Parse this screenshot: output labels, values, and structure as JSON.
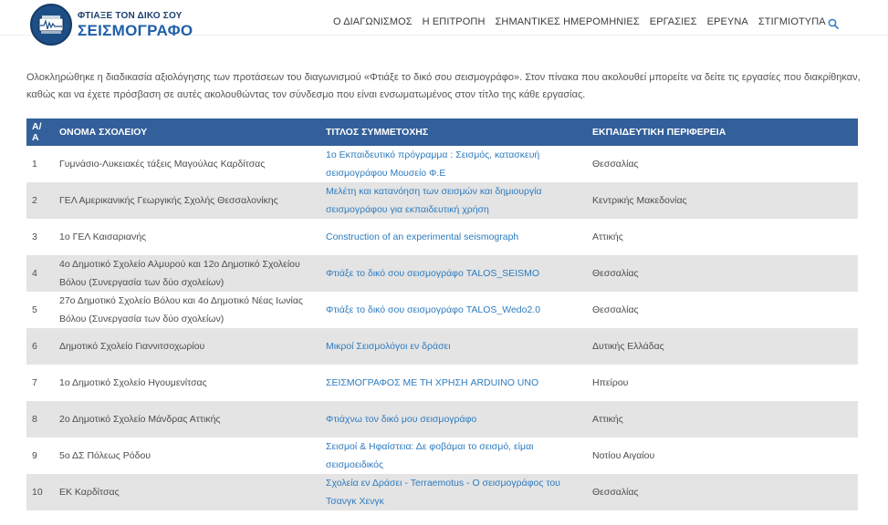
{
  "header": {
    "logo": {
      "line1": "ΦΤΙΑΞΕ ΤΟΝ ΔΙΚΟ ΣΟΥ",
      "line2": "ΣΕΙΣΜΟΓΡΑΦΟ"
    },
    "nav": [
      {
        "label": "Ο ΔΙΑΓΩΝΙΣΜΟΣ"
      },
      {
        "label": "Η ΕΠΙΤΡΟΠΗ"
      },
      {
        "label": "ΣΗΜΑΝΤΙΚΕΣ ΗΜΕΡΟΜΗΝΙΕΣ"
      },
      {
        "label": "ΕΡΓΑΣΙΕΣ"
      },
      {
        "label": "ΕΡΕΥΝΑ"
      },
      {
        "label": "ΣΤΙΓΜΙΟΤΥΠΑ"
      }
    ]
  },
  "intro": "Ολοκληρώθηκε η διαδικασία αξιολόγησης των προτάσεων του διαγωνισμού «Φτιάξε το δικό σου σεισμογράφο». Στον πίνακα που ακολουθεί μπορείτε να δείτε τις εργασίες που διακρίθηκαν, καθώς και να έχετε πρόσβαση σε αυτές ακολουθώντας τον σύνδεσμο που είναι ενσωματωμένος στον τίτλο της κάθε εργασίας.",
  "table": {
    "headers": [
      "Α/Α",
      "ΟΝΟΜΑ ΣΧΟΛΕΙΟΥ",
      "ΤΙΤΛΟΣ ΣΥΜΜΕΤΟΧΗΣ",
      "ΕΚΠΑΙΔΕΥΤΙΚΗ ΠΕΡΙΦΕΡΕΙΑ"
    ],
    "rows": [
      {
        "num": "1",
        "school": "Γυμνάσιο-Λυκειακές τάξεις Μαγούλας Καρδίτσας",
        "title": "1ο Εκπαιδευτικό πρόγραμμα : Σεισμός, κατασκευή σεισμογράφου Μουσείο Φ.Ε",
        "region": "Θεσσαλίας"
      },
      {
        "num": "2",
        "school": "ΓΕΛ Αμερικανικής Γεωργικής Σχολής Θεσσαλονίκης",
        "title": "Μελέτη και κατανόηση των σεισμών και δημιουργία σεισμογράφου για εκπαιδευτική χρήση",
        "region": "Κεντρικής Μακεδονίας"
      },
      {
        "num": "3",
        "school": "1ο ΓΕΛ Καισαριανής",
        "title": "Construction of an experimental seismograph",
        "region": "Αττικής"
      },
      {
        "num": "4",
        "school": "4ο Δημοτικό Σχολείο Αλμυρού και 12ο Δημοτικό Σχολείου Βόλου (Συνεργασία των δύο σχολείων)",
        "title": "Φτιάξε το δικό σου σεισμογράφο TALOS_SEISMO",
        "region": "Θεσσαλίας"
      },
      {
        "num": "5",
        "school": "27ο Δημοτικό Σχολείο Βόλου και 4ο Δημοτικό Νέας Ιωνίας Βόλου (Συνεργασία των δύο σχολείων)",
        "title": "Φτιάξε το δικό σου σεισμογράφο TALOS_Wedo2.0",
        "region": "Θεσσαλίας"
      },
      {
        "num": "6",
        "school": "Δημοτικό Σχολείο Γιαννιτσοχωρίου",
        "title": "Μικροί Σεισμολόγοι εν δράσει",
        "region": "Δυτικής Ελλάδας"
      },
      {
        "num": "7",
        "school": "1ο Δημοτικό Σχολείο Ηγουμενίτσας",
        "title": "ΣΕΙΣΜΟΓΡΑΦΟΣ ΜΕ ΤΗ ΧΡΗΣΗ ARDUINO UNO",
        "region": "Ηπείρου"
      },
      {
        "num": "8",
        "school": "2ο Δημοτικό Σχολείο Μάνδρας Αττικής",
        "title": "Φτιάχνω τον δικό μου σεισμογράφο",
        "region": "Αττικής"
      },
      {
        "num": "9",
        "school": "5ο ΔΣ Πόλεως Ρόδου",
        "title": "Σεισμοί & Ηφαίστεια: Δε φοβάμαι το σεισμό, είμαι σεισμοειδικός",
        "region": "Νοτίου Αιγαίου"
      },
      {
        "num": "10",
        "school": "ΕΚ Καρδίτσας",
        "title": "Σχολεία εν Δράσει - Terraemotus - Ο σεισμογράφος του Τσανγκ Χενγκ",
        "region": "Θεσσαλίας"
      }
    ]
  },
  "colors": {
    "header_bg": "#33609a",
    "link": "#2d7bbf",
    "stripe": "#e4e4e4"
  }
}
